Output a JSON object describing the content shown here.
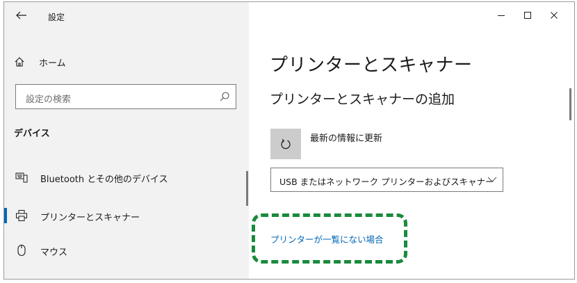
{
  "window": {
    "title": "設定",
    "controls": [
      "minimize-icon",
      "maximize-icon",
      "close-icon"
    ]
  },
  "sidebar": {
    "home_label": "ホーム",
    "search_placeholder": "設定の検索",
    "section_label": "デバイス",
    "items": [
      {
        "label": "Bluetooth とその他のデバイス",
        "icon": "bluetooth-devices-icon",
        "active": false
      },
      {
        "label": "プリンターとスキャナー",
        "icon": "printer-icon",
        "active": true
      },
      {
        "label": "マウス",
        "icon": "mouse-icon",
        "active": false
      }
    ]
  },
  "main": {
    "title": "プリンターとスキャナー",
    "subtitle": "プリンターとスキャナーの追加",
    "refresh_label": "最新の情報に更新",
    "dropdown_value": "USB またはネットワーク プリンターおよびスキャナー",
    "link_label": "プリンターが一覧にない場合"
  },
  "colors": {
    "accent": "#0067b8",
    "highlight": "#1a8a3c",
    "sidebar_bg": "#f2f2f2"
  }
}
